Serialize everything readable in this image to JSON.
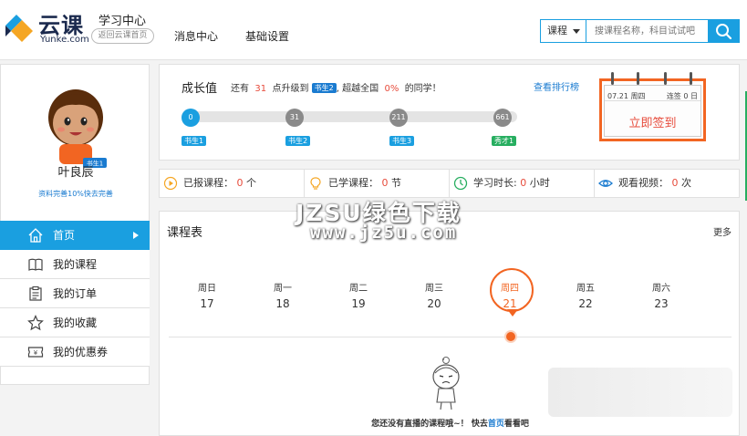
{
  "header": {
    "brand": "云课",
    "brand_sub": "Yunke.com",
    "learning_center": "学习中心",
    "back_home": "返回云课首页",
    "nav": [
      {
        "label": "消息中心"
      },
      {
        "label": "基础设置"
      }
    ],
    "search": {
      "category": "课程",
      "placeholder": "搜课程名称，科目试试吧"
    }
  },
  "sidebar": {
    "user_name": "叶良辰",
    "avatar_badge": "书生1",
    "profile_link": "资料完善10%快去完善",
    "menu": [
      {
        "label": "首页",
        "icon": "home-icon",
        "active": true
      },
      {
        "label": "我的课程",
        "icon": "book-icon"
      },
      {
        "label": "我的订单",
        "icon": "order-icon"
      },
      {
        "label": "我的收藏",
        "icon": "star-icon"
      },
      {
        "label": "我的优惠券",
        "icon": "coupon-icon"
      }
    ]
  },
  "growth": {
    "title": "成长值",
    "desc_1": "还有",
    "points_needed": "31",
    "desc_2": "点升级到",
    "next_level": "书生2",
    "desc_3": "超越全国",
    "beat_percent": "0%",
    "desc_4": "的同学！",
    "rank_link": "查看排行榜",
    "nodes": [
      {
        "value": "0",
        "label": "书生1"
      },
      {
        "value": "31",
        "label": "书生2"
      },
      {
        "value": "211",
        "label": "书生3"
      },
      {
        "value": "661",
        "label": "秀才1"
      }
    ]
  },
  "checkin": {
    "date": "07.21 周四",
    "streak": "连签 0 日",
    "button": "立即签到",
    "accent": "#f26522"
  },
  "stats": [
    {
      "label": "已报课程：",
      "value": "0",
      "unit": "个",
      "icon": "play-icon"
    },
    {
      "label": "已学课程：",
      "value": "0",
      "unit": "节",
      "icon": "bulb-icon"
    },
    {
      "label": "学习时长:",
      "value": "0",
      "unit": "小时",
      "icon": "clock-icon"
    },
    {
      "label": "观看视频：",
      "value": "0",
      "unit": "次",
      "icon": "eye-icon"
    }
  ],
  "schedule": {
    "title": "课程表",
    "more": "更多",
    "days": [
      {
        "name": "周日",
        "num": "17"
      },
      {
        "name": "周一",
        "num": "18"
      },
      {
        "name": "周二",
        "num": "19"
      },
      {
        "name": "周三",
        "num": "20"
      },
      {
        "name": "周四",
        "num": "21",
        "active": true
      },
      {
        "name": "周五",
        "num": "22"
      },
      {
        "name": "周六",
        "num": "23"
      }
    ],
    "empty_prefix": "您还没有直播的课程哦~！ 快去",
    "empty_link": "首页",
    "empty_suffix": "看看吧"
  },
  "watermark": {
    "text": "JZSU绿色下载",
    "url": "www.jz5u.com"
  },
  "colors": {
    "primary": "#1a9fe0",
    "accent": "#f26522",
    "red": "#e74c3c"
  }
}
